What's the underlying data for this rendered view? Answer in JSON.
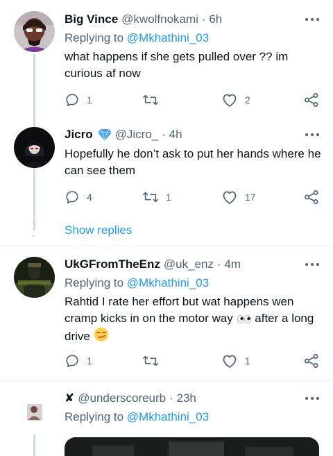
{
  "tweets": [
    {
      "name": "Big Vince",
      "handle": "@kwolfnokami",
      "time": "· 6h",
      "replying_prefix": "Replying to ",
      "replying_to": "@Mkhathini_03",
      "text": "what happens if she gets pulled over ?? im curious af now",
      "replies": "1",
      "retweets": "",
      "likes": "2"
    },
    {
      "name": "Jicro",
      "handle": "@Jicro_",
      "time": "· 4h",
      "verified_icon": "blue-diamond-emoji",
      "text": "Hopefully he don’t ask to put her hands where he can see them",
      "replies": "4",
      "retweets": "1",
      "likes": "17"
    },
    {
      "name": "UkGFromTheEnz",
      "handle": "@uk_enz",
      "time": "· 4m",
      "replying_prefix": "Replying to ",
      "replying_to": "@Mkhathini_03",
      "text": "Rahtid I rate her effort but wat happens wen cramp kicks in on the motor way",
      "text_after_eyes": " after a long drive",
      "replies": "1",
      "retweets": "",
      "likes": "1"
    },
    {
      "name": "✘",
      "handle": "@underscoreurb",
      "time": "· 23h",
      "replying_prefix": "Replying to ",
      "replying_to": "@Mkhathini_03"
    }
  ],
  "show_replies": "Show replies",
  "colors": {
    "accent": "#1d9bf0",
    "secondary_text": "#536471",
    "thread_line": "#cfd9de",
    "divider": "#eff3f4"
  }
}
